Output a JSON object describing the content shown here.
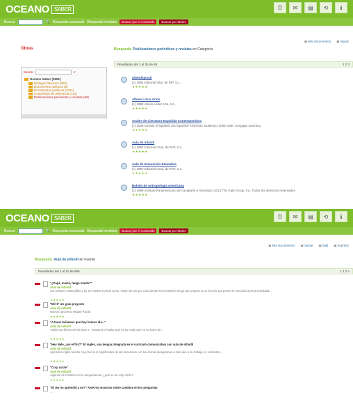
{
  "brand": {
    "name": "OCEANO",
    "sub": "SABER"
  },
  "toolbar_icons": [
    "print-icon",
    "mail-icon",
    "save-icon",
    "sync-icon",
    "info-icon"
  ],
  "searchbar": {
    "label": "Buscar",
    "advanced": "Búsqueda avanzada",
    "thematic": "Búsqueda temática",
    "select1": "Buscar por el contenido",
    "select2": "Buscar por títulos"
  },
  "panel1": {
    "topright": [
      "Mis documentos",
      "Vaciar"
    ],
    "left_title": "Obras",
    "tree_search_label": "Buscar",
    "tree_go": "Ir",
    "tree_root": "Océano Saber (2501)",
    "tree_items": [
      "Diálogos literarios (875)",
      "Documentos básicos (6)",
      "Documentos jurídicos (1121)",
      "Contenidos de referencia (112)",
      "Publicaciones periódicas y revistas (68)"
    ],
    "crumb_label": "Búsqueda:",
    "crumb_value": "Publicaciones periódicas y revistas",
    "crumb_tail": "en Categoría",
    "results_text": "Resultados del 1 al 25 de 68",
    "pager": "1 2 3",
    "results": [
      {
        "title": "Abendsprach",
        "meta": "(c) 1994 Editorial Vital, de RIP, S.L.",
        "stars": "★★★★★"
      },
      {
        "title": "Album Lotus Armo",
        "meta": "(c) 1992 Album Letter Arte, S.L.",
        "stars": "★★★★★"
      },
      {
        "title": "Anales de Literatura Española Contemporánea",
        "meta": "(c) 2006 Society of Spanish and Spanish-American Studies(c) 2008 Gale, Cengage Learning",
        "stars": "★★★★★"
      },
      {
        "title": "Aula de infantil",
        "meta": "(c) 1997 Editorial Graó, de IRIF, S.L.",
        "stars": "★★★★★"
      },
      {
        "title": "Aula de Innovación Educativa",
        "meta": "(c) 1997 Editorial Graó, de IRIF, S.L.",
        "stars": "★★★★★"
      },
      {
        "title": "Boletín de Antropología Americana",
        "meta": "(c) 1999 Instituto Panamericano de Geografía e Historia(c) 2013 The Gale Group, Inc. Todos los derechos reservados",
        "stars": "★★★★★"
      }
    ]
  },
  "panel2": {
    "topright": [
      "Mis documentos",
      "Vaciar",
      "Mail",
      "Imprimir"
    ],
    "crumb_label": "Búsqueda:",
    "crumb_value": "Aula de infantil",
    "crumb_tail": "en Fuente",
    "results_text": "Resultados del 1 al 10 de 890",
    "pager": "1 2 3 >",
    "results": [
      {
        "title": "\"¿Papá, mamá, tengo miedo?\"",
        "source": "Aula de infantil",
        "desc": "Con a llares estas pillos y tor es miedos normal como. Tanto los asi que cosa tiende los imcasimia tengo tan a apene a un nno do aus puerto el nnoundo aces preciosidad...",
        "stars": "★★★★★"
      },
      {
        "title": "\"Mi+1\" Un gran proyecto",
        "source": "Aula de infantil",
        "desc": "Nuestro proyecto Miguel Pazán",
        "stars": "★★★★★"
      },
      {
        "title": "\"A tocar bailamos que hoy hemos ido...\"",
        "source": "Aula de infantil",
        "desc": "Todos sus bisem de los tiros 4 - maestros el bailar que es su estilo que es su lunes de...",
        "stars": "★★★★★"
      },
      {
        "title": "\"Hey Nale, ¿en el friv?\" El inglés, una lengua integrada en el currículo comunicativo con aula de infantil",
        "source": "Aula de infantil",
        "desc": "Aprender inglés resulta muy fácil si el significativo de las relaciones con los demás ideogramas a más que a su trabajo en contextos...",
        "stars": "★★★★★"
      },
      {
        "title": "\"Crop circle\"",
        "source": "Aula de infantil",
        "desc": "Algunos de nosotros no lo preguntamos: ¿qué es un crop circle?",
        "stars": "★★★★★"
      },
      {
        "title": "\"El rey no aprendió a no?\" Ante los recursos sobre cambios en los preguntas",
        "source": "Aula de infantil",
        "desc": "...",
        "stars": ""
      }
    ]
  }
}
